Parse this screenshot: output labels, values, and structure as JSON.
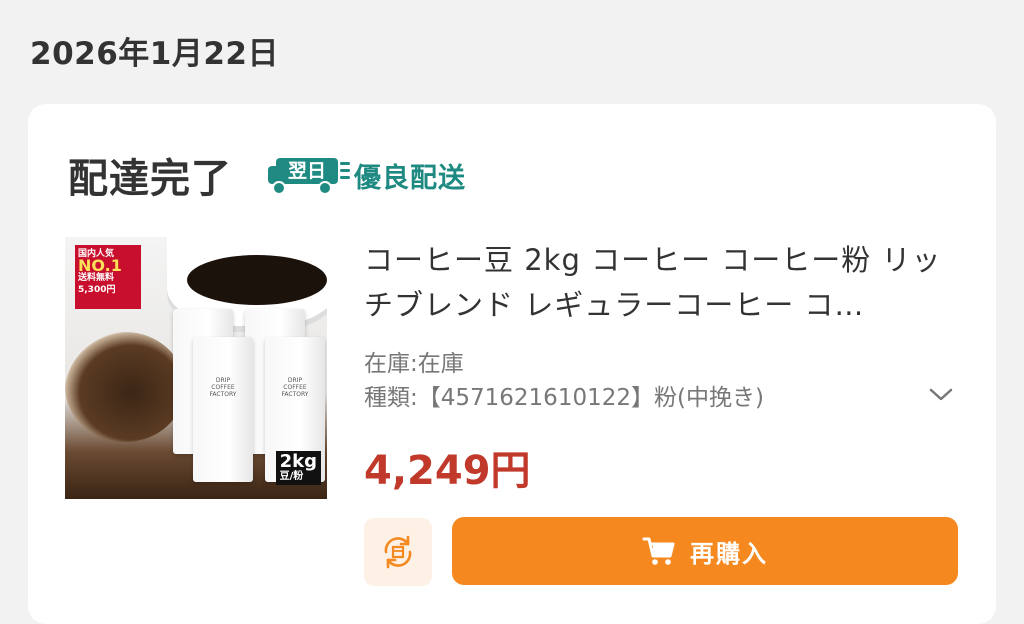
{
  "order": {
    "date": "2026年1月22日",
    "status": "配達完了",
    "shipping_badge_icon": "truck-icon",
    "shipping_badge_prefix": "翌日",
    "shipping_badge_label": "優良配送"
  },
  "product": {
    "title": "コーヒー豆 2kg コーヒー コーヒー粉 リッチブレンド レギュラーコーヒー コ…",
    "stock": "在庫:在庫",
    "variant": "種類:【4571621610122】粉(中挽き)",
    "price": "4,249円",
    "image": {
      "badge_line1": "国内人気",
      "badge_line2": "NO.1",
      "badge_line3": "送料無料",
      "badge_line4": "5,300円",
      "bag_text_1": "DRIP",
      "bag_text_2": "COFFEE",
      "bag_text_3": "FACTORY",
      "size": "2kg",
      "size_sub": "豆/粉"
    }
  },
  "actions": {
    "reorder_icon": "refresh-box-icon",
    "rebuy_label": "再購入",
    "rebuy_icon": "cart-icon"
  },
  "colors": {
    "accent_orange": "#f5891f",
    "price_red": "#c0392b",
    "shipping_teal": "#1f8a82"
  }
}
